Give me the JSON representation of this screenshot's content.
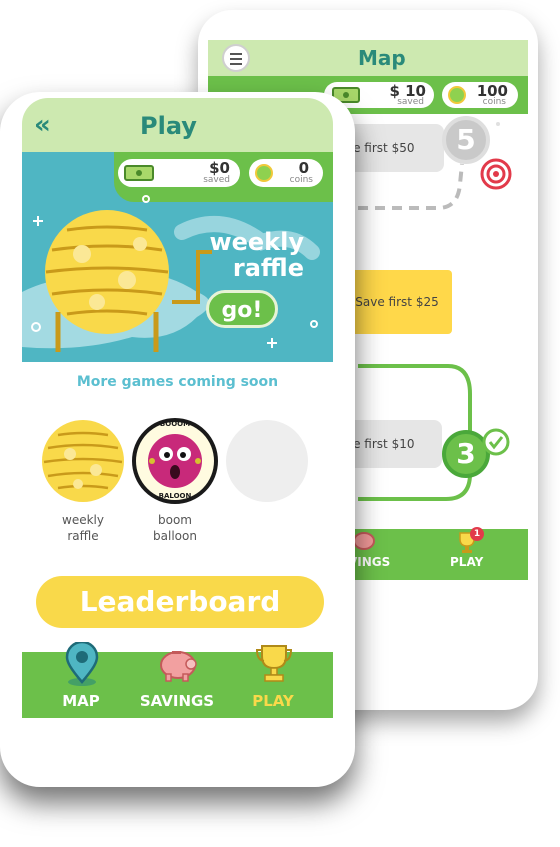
{
  "back_screen": {
    "title": "Map",
    "stats": {
      "saved_amount": "$ 10",
      "saved_label": "saved",
      "coins_amount": "100",
      "coins_label": "coins"
    },
    "milestones": [
      {
        "text": "ve first $50",
        "level": "5"
      },
      {
        "text": "Save first $25"
      },
      {
        "text": "ve first $10",
        "level": "3"
      }
    ],
    "nav": {
      "savings_label": "VINGS",
      "play_label": "PLAY",
      "play_badge": "1"
    }
  },
  "front_screen": {
    "title": "Play",
    "stats": {
      "saved_amount": "$0",
      "saved_label": "saved",
      "coins_amount": "0",
      "coins_label": "coins"
    },
    "banner": {
      "line1": "weekly",
      "line2": "raffle",
      "go_label": "go!"
    },
    "more_games": "More games coming soon",
    "games": [
      {
        "label1": "weekly",
        "label2": "raffle"
      },
      {
        "label1": "boom",
        "label2": "balloon"
      }
    ],
    "balloon_ring_top": "BOOOM",
    "balloon_ring_bottom": "BALOON",
    "leaderboard_label": "Leaderboard",
    "nav": [
      {
        "label": "MAP",
        "icon": "map-pin-icon"
      },
      {
        "label": "SAVINGS",
        "icon": "piggy-bank-icon"
      },
      {
        "label": "PLAY",
        "icon": "trophy-icon",
        "active": true
      }
    ]
  },
  "colors": {
    "green": "#6cc04a",
    "teal": "#2a8a7a",
    "yellow": "#f9d94a",
    "banner": "#4fb6c3",
    "active_nav": "#f9d94a"
  }
}
